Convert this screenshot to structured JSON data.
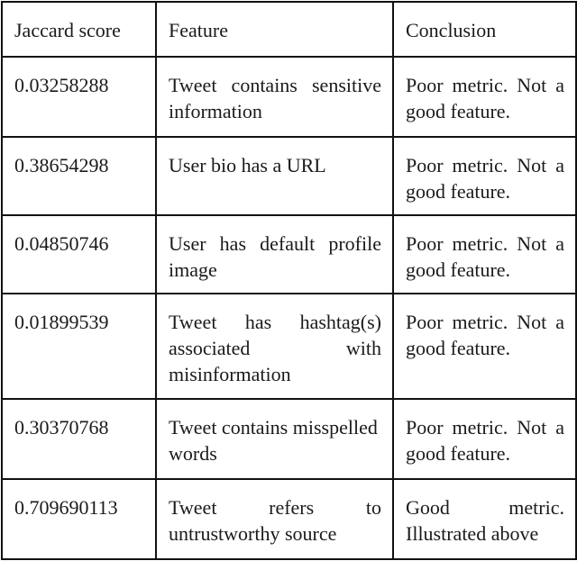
{
  "table": {
    "headers": [
      "Jaccard score",
      "Feature",
      "Conclusion"
    ],
    "rows": [
      {
        "score": "0.03258288",
        "feature": "Tweet contains sensitive information",
        "conclusion": "Poor metric. Not a good feature."
      },
      {
        "score": "0.38654298",
        "feature": "User bio has a URL",
        "conclusion": "Poor metric. Not a good feature."
      },
      {
        "score": "0.04850746",
        "feature": "User has default profile image",
        "conclusion": "Poor metric. Not a good feature."
      },
      {
        "score": "0.01899539",
        "feature": "Tweet has hashtag(s) associated with misinformation",
        "conclusion": "Poor metric. Not a good feature."
      },
      {
        "score": "0.30370768",
        "feature": "Tweet contains misspelled words",
        "conclusion": "Poor metric. Not a good feature."
      },
      {
        "score": "0.709690113",
        "feature": "Tweet refers to untrustworthy source",
        "conclusion": "Good metric. Illustrated above"
      }
    ]
  }
}
